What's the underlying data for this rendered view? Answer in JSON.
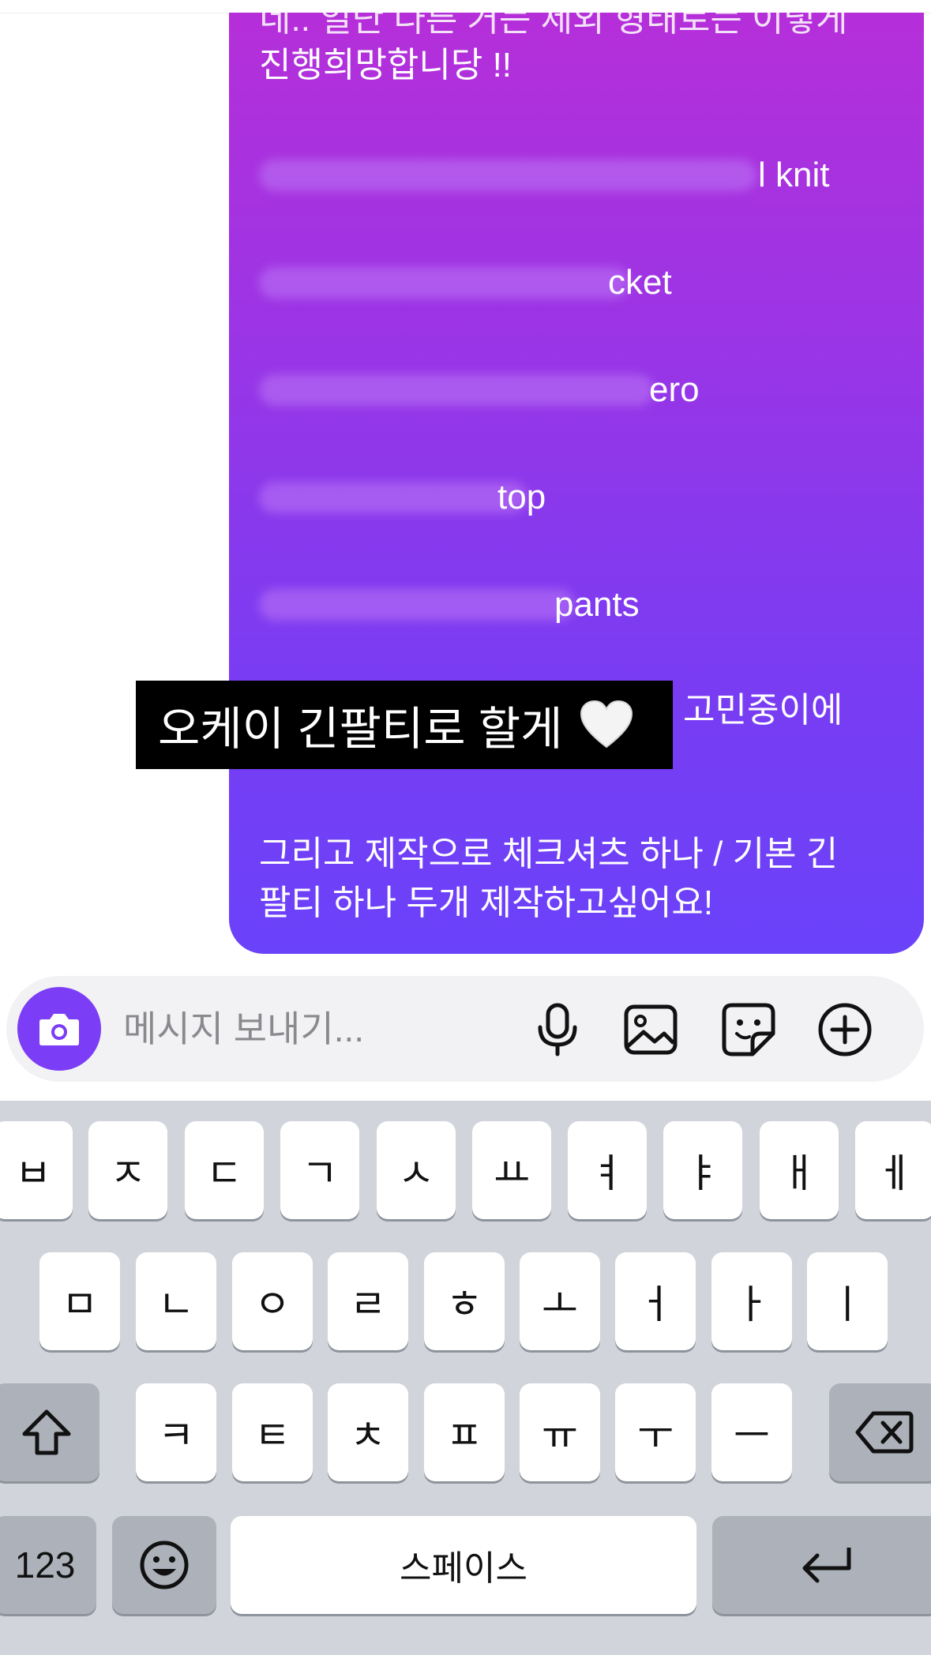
{
  "message": {
    "top_cut_line": "네.. 일단 다른 거는 제외 형태로는 이렇게",
    "line2": "진행희망합니당 !!",
    "items": [
      {
        "visible_text": "l knit"
      },
      {
        "visible_text": "cket"
      },
      {
        "visible_text": "ero"
      },
      {
        "visible_text": "top"
      },
      {
        "visible_text": "pants"
      }
    ],
    "partial_line": "고민중이에",
    "closing": "그리고 제작으로 체크셔츠 하나 / 기본 긴",
    "closing2": "팔티 하나 두개 제작하고싶어요!"
  },
  "caption": {
    "text": "오케이 긴팔티로 할게",
    "emoji_icon": "white-heart-icon"
  },
  "composer": {
    "placeholder": "메시지 보내기...",
    "icons": [
      "camera-icon",
      "microphone-icon",
      "gallery-icon",
      "sticker-icon",
      "plus-circle-icon"
    ]
  },
  "keyboard": {
    "row1": [
      "ㅂ",
      "ㅈ",
      "ㄷ",
      "ㄱ",
      "ㅅ",
      "ㅛ",
      "ㅕ",
      "ㅑ",
      "ㅐ",
      "ㅔ"
    ],
    "row2": [
      "ㅁ",
      "ㄴ",
      "ㅇ",
      "ㄹ",
      "ㅎ",
      "ㅗ",
      "ㅓ",
      "ㅏ",
      "ㅣ"
    ],
    "row3": [
      "ㅋ",
      "ㅌ",
      "ㅊ",
      "ㅍ",
      "ㅠ",
      "ㅜ",
      "ㅡ"
    ],
    "numbers_label": "123",
    "space_label": "스페이스",
    "special_icons": [
      "shift-icon",
      "backspace-icon",
      "emoji-icon",
      "return-icon"
    ]
  },
  "colors": {
    "bubble_top": "#b52fd9",
    "bubble_bottom": "#6a42fa",
    "accent": "#7b3df5",
    "keyboard_bg": "#d1d4db"
  }
}
